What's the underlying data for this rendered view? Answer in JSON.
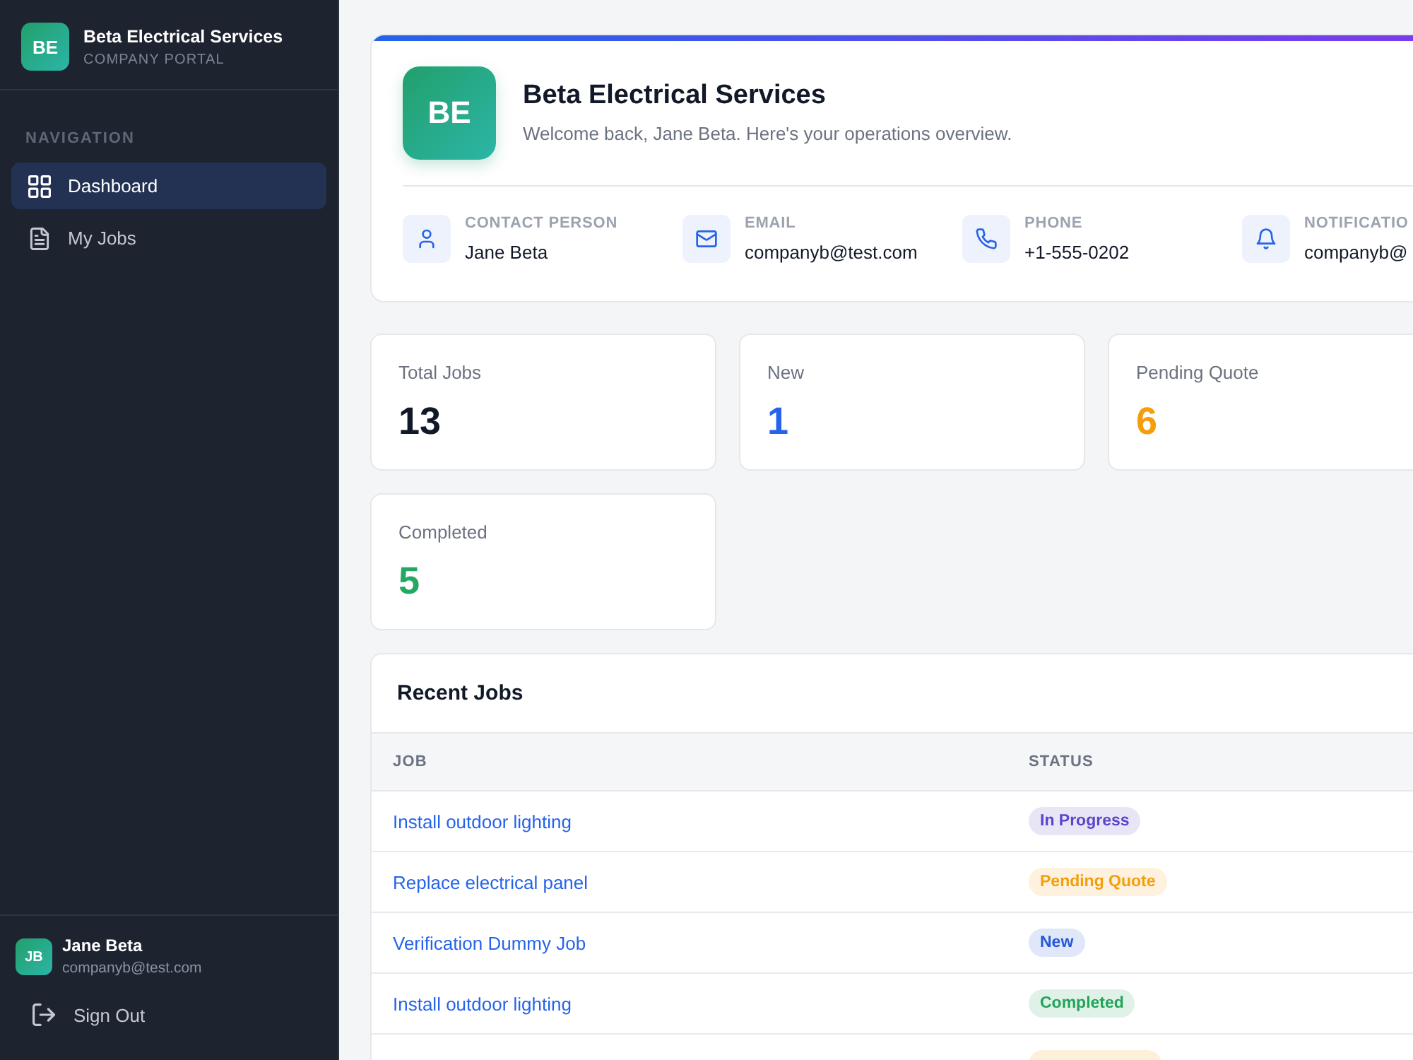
{
  "sidebar": {
    "logo": "BE",
    "company": "Beta Electrical Services",
    "subtitle": "COMPANY PORTAL",
    "section_label": "NAVIGATION",
    "items": [
      {
        "label": "Dashboard",
        "selected": true
      },
      {
        "label": "My Jobs",
        "selected": false
      }
    ],
    "user": {
      "initials": "JB",
      "name": "Jane Beta",
      "email": "companyb@test.com"
    },
    "sign_out": "Sign Out"
  },
  "header": {
    "initials": "BE",
    "title": "Beta Electrical Services",
    "welcome": "Welcome back, Jane Beta. Here's your operations overview.",
    "contacts": [
      {
        "label": "CONTACT PERSON",
        "value": "Jane Beta"
      },
      {
        "label": "EMAIL",
        "value": "companyb@test.com"
      },
      {
        "label": "PHONE",
        "value": "+1-555-0202"
      },
      {
        "label": "NOTIFICATIO",
        "value": "companyb@"
      }
    ]
  },
  "stats": [
    {
      "label": "Total Jobs",
      "value": "13",
      "color": "#111827"
    },
    {
      "label": "New",
      "value": "1",
      "color": "#2563eb"
    },
    {
      "label": "Pending Quote",
      "value": "6",
      "color": "#f59e0b"
    },
    {
      "label": "Completed",
      "value": "5",
      "color": "#22a861"
    }
  ],
  "recent_jobs": {
    "title": "Recent Jobs",
    "columns": [
      "JOB",
      "STATUS"
    ],
    "rows": [
      {
        "job": "Install outdoor lighting",
        "status": "In Progress",
        "color": "#5b45c9"
      },
      {
        "job": "Replace electrical panel",
        "status": "Pending Quote",
        "color": "#f59e0b"
      },
      {
        "job": "Verification Dummy Job",
        "status": "New",
        "color": "#2557d6"
      },
      {
        "job": "Install outdoor lighting",
        "status": "Completed",
        "color": "#22a35a"
      },
      {
        "color": "#fdf0d8"
      }
    ]
  }
}
